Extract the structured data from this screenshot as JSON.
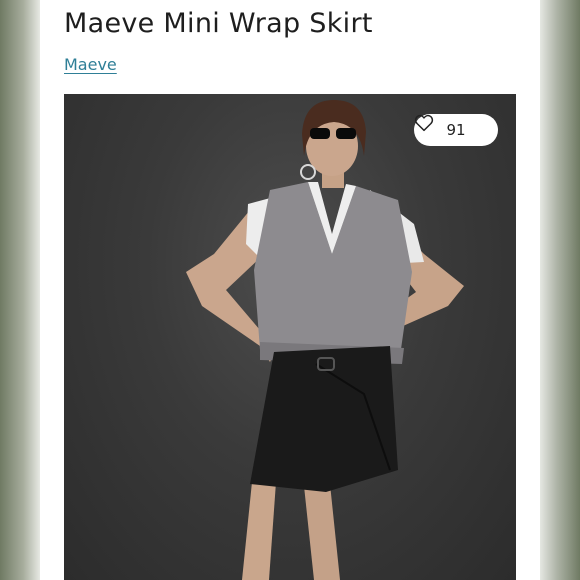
{
  "listing": {
    "title": "Maeve Mini Wrap Skirt",
    "brand": "Maeve",
    "likes": "91",
    "like_icon": "heart-outline-icon"
  },
  "colors": {
    "brand_link": "#2f7f97",
    "photo_background": "#3a3a3a",
    "sweater": "#8d8b8f",
    "skirt": "#1a1a1a"
  }
}
